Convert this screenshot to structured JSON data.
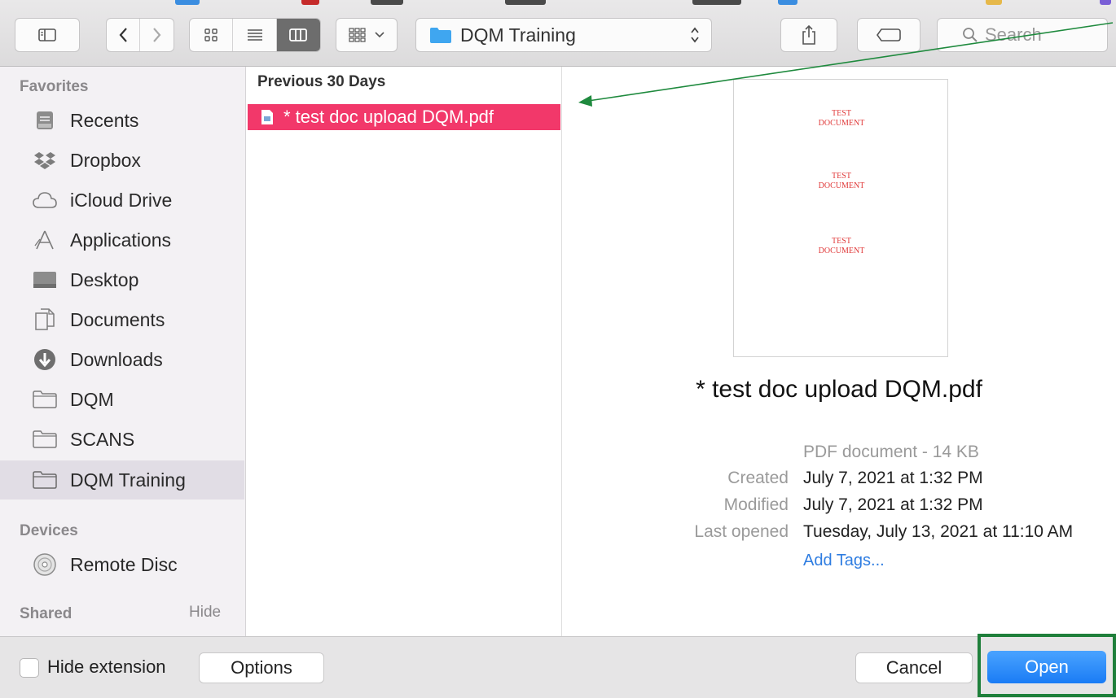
{
  "toolbar": {
    "path_label": "DQM Training",
    "search_placeholder": "Search"
  },
  "sidebar": {
    "favorites_title": "Favorites",
    "favorites": [
      {
        "label": "Recents",
        "icon": "recents-icon"
      },
      {
        "label": "Dropbox",
        "icon": "dropbox-icon"
      },
      {
        "label": "iCloud Drive",
        "icon": "cloud-icon"
      },
      {
        "label": "Applications",
        "icon": "applications-icon"
      },
      {
        "label": "Desktop",
        "icon": "desktop-icon"
      },
      {
        "label": "Documents",
        "icon": "documents-icon"
      },
      {
        "label": "Downloads",
        "icon": "downloads-icon"
      },
      {
        "label": "DQM",
        "icon": "folder-icon"
      },
      {
        "label": "SCANS",
        "icon": "folder-icon"
      },
      {
        "label": "DQM Training",
        "icon": "folder-icon",
        "selected": true
      }
    ],
    "devices_title": "Devices",
    "devices": [
      {
        "label": "Remote Disc",
        "icon": "disc-icon"
      }
    ],
    "shared_title": "Shared",
    "hide_label": "Hide"
  },
  "column": {
    "header": "Previous 30 Days",
    "selected_file": "* test doc upload DQM.pdf"
  },
  "preview": {
    "thumbnail_stamps": [
      {
        "line1": "TEST",
        "line2": "DOCUMENT"
      },
      {
        "line1": "TEST",
        "line2": "DOCUMENT"
      },
      {
        "line1": "TEST",
        "line2": "DOCUMENT"
      }
    ],
    "title": "* test doc upload DQM.pdf",
    "kind": "PDF document - 14 KB",
    "created_label": "Created",
    "created_value": "July 7, 2021 at 1:32 PM",
    "modified_label": "Modified",
    "modified_value": "July 7, 2021 at 1:32 PM",
    "last_opened_label": "Last opened",
    "last_opened_value": "Tuesday, July 13, 2021 at 11:10 AM",
    "add_tags": "Add Tags..."
  },
  "bottom": {
    "hide_extension": "Hide extension",
    "options": "Options",
    "cancel": "Cancel",
    "open": "Open"
  },
  "colors": {
    "selection": "#f2386a",
    "primary_button": "#1a7cf5",
    "annotation_green": "#1f7f3b",
    "link": "#2f7de1"
  }
}
